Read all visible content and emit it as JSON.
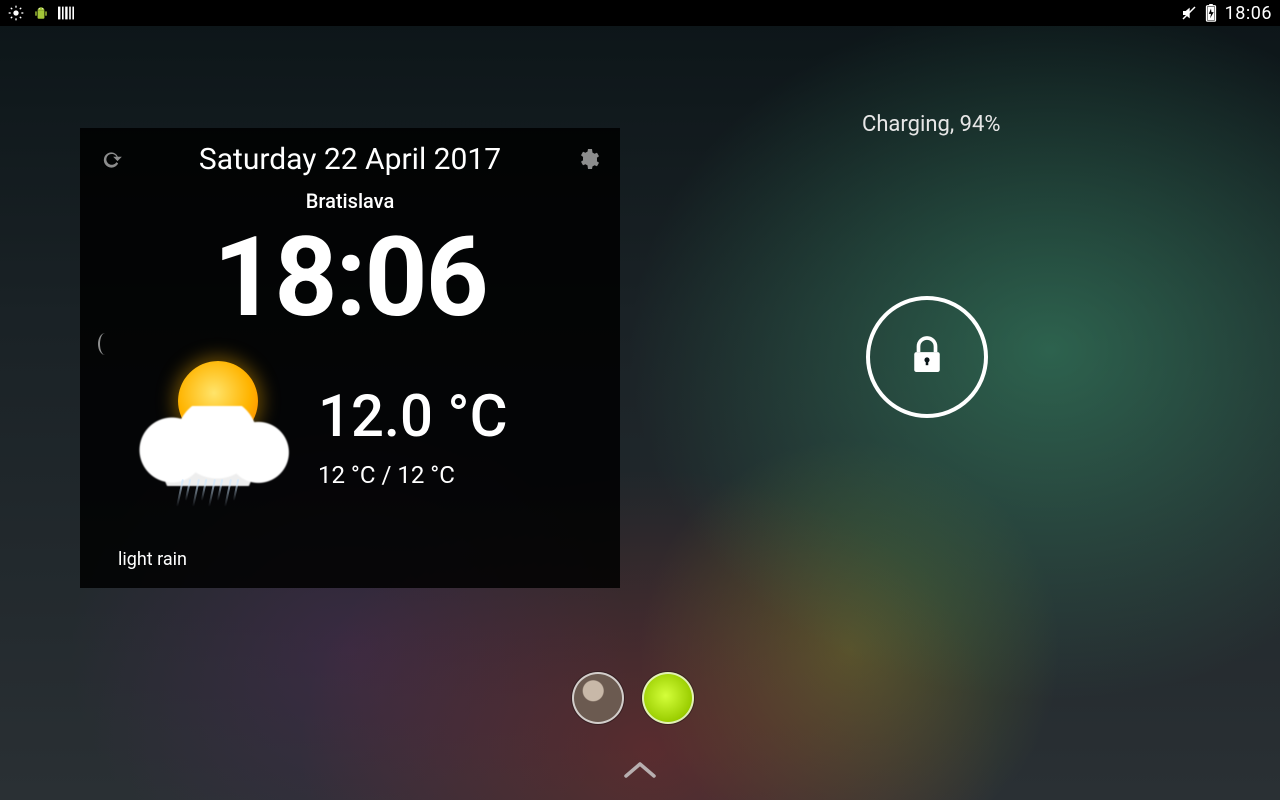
{
  "status_bar": {
    "time": "18:06",
    "icons": {
      "brightness": "brightness-icon",
      "android_debug": "android-debug-icon",
      "barcode": "barcode-icon",
      "mute": "mute-icon",
      "battery_charging": "battery-charging-icon"
    }
  },
  "widget": {
    "date": "Saturday 22 April 2017",
    "city": "Bratislava",
    "clock": "18:06",
    "temperature": "12.0 °C",
    "temp_range": "12 °C / 12 °C",
    "condition": "light rain"
  },
  "lockscreen": {
    "charging_text": "Charging, 94%"
  }
}
